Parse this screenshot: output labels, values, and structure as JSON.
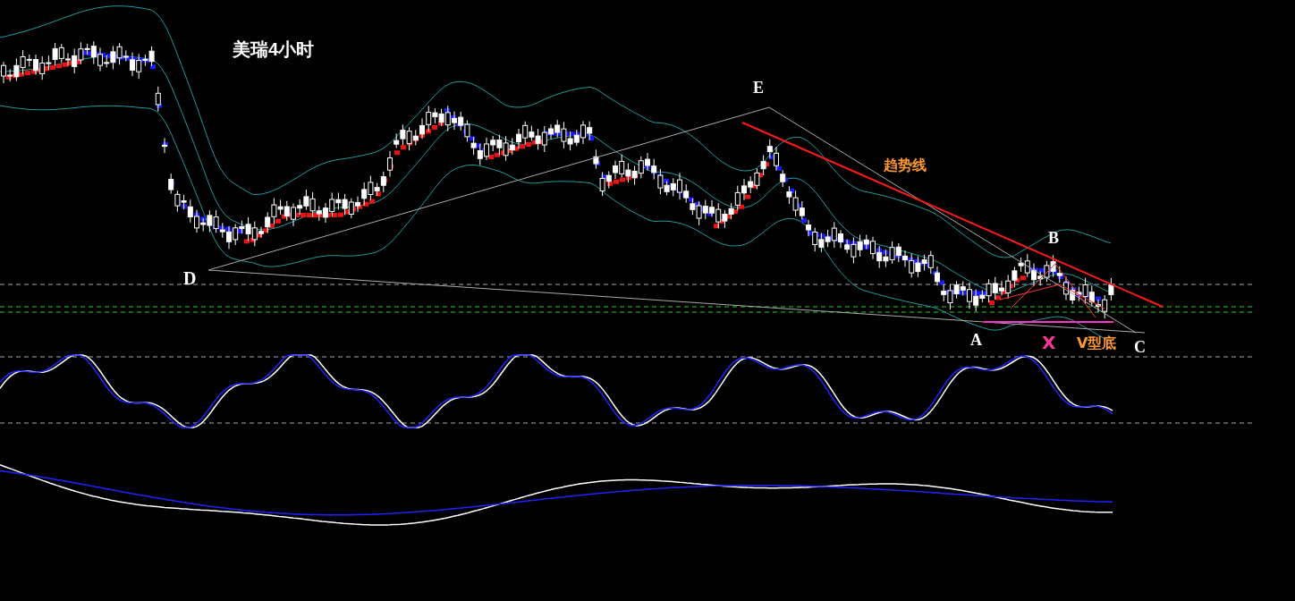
{
  "title": "美瑞4小时",
  "labels": [
    {
      "text": "E",
      "color": "#ffffff"
    },
    {
      "text": "趋势线",
      "color": "#ff9933"
    },
    {
      "text": "B",
      "color": "#ffffff"
    },
    {
      "text": "D",
      "color": "#ffffff"
    },
    {
      "text": "A",
      "color": "#ffffff"
    },
    {
      "text": "X",
      "color": "#ff3399"
    },
    {
      "text": "V型底",
      "color": "#ff9933"
    },
    {
      "text": "C",
      "color": "#ffffff"
    }
  ]
}
